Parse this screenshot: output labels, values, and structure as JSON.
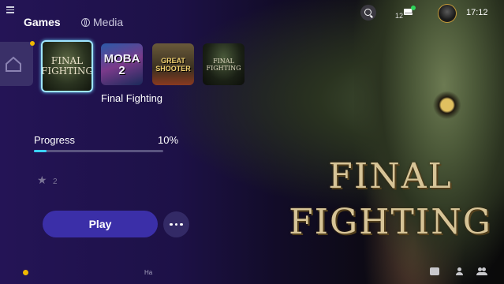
{
  "header": {
    "tabs": [
      {
        "label": "Games",
        "active": true
      },
      {
        "label": "Media",
        "active": false
      }
    ],
    "mail_count": "12",
    "time": "17:12",
    "icons": [
      "menu-icon",
      "globe-icon",
      "search-icon",
      "mail-icon",
      "avatar"
    ]
  },
  "games_row": {
    "tiles": [
      {
        "label": "FINAL FIGHTING",
        "selected": true
      },
      {
        "label": "MOBA 2"
      },
      {
        "label": "GREAT SHOOTER"
      },
      {
        "label": "FINAL FIGHTING"
      }
    ],
    "selected_title": "Final Fighting"
  },
  "details": {
    "progress_label": "Progress",
    "progress_value": "10%",
    "progress_fraction": 0.1,
    "trophy_count": "2",
    "play_label": "Play"
  },
  "hero": {
    "title_line1": "FINAL",
    "title_line2": "FIGHTING"
  },
  "bottom_bar": {
    "hint": "Ha",
    "icons": [
      "chat-icon",
      "person-icon",
      "group-icon"
    ]
  },
  "colors": {
    "accent": "#3ad2ff",
    "play_button": "#3b2fa8",
    "notification_dot": "#f0b800",
    "online_dot": "#2fd35a"
  }
}
